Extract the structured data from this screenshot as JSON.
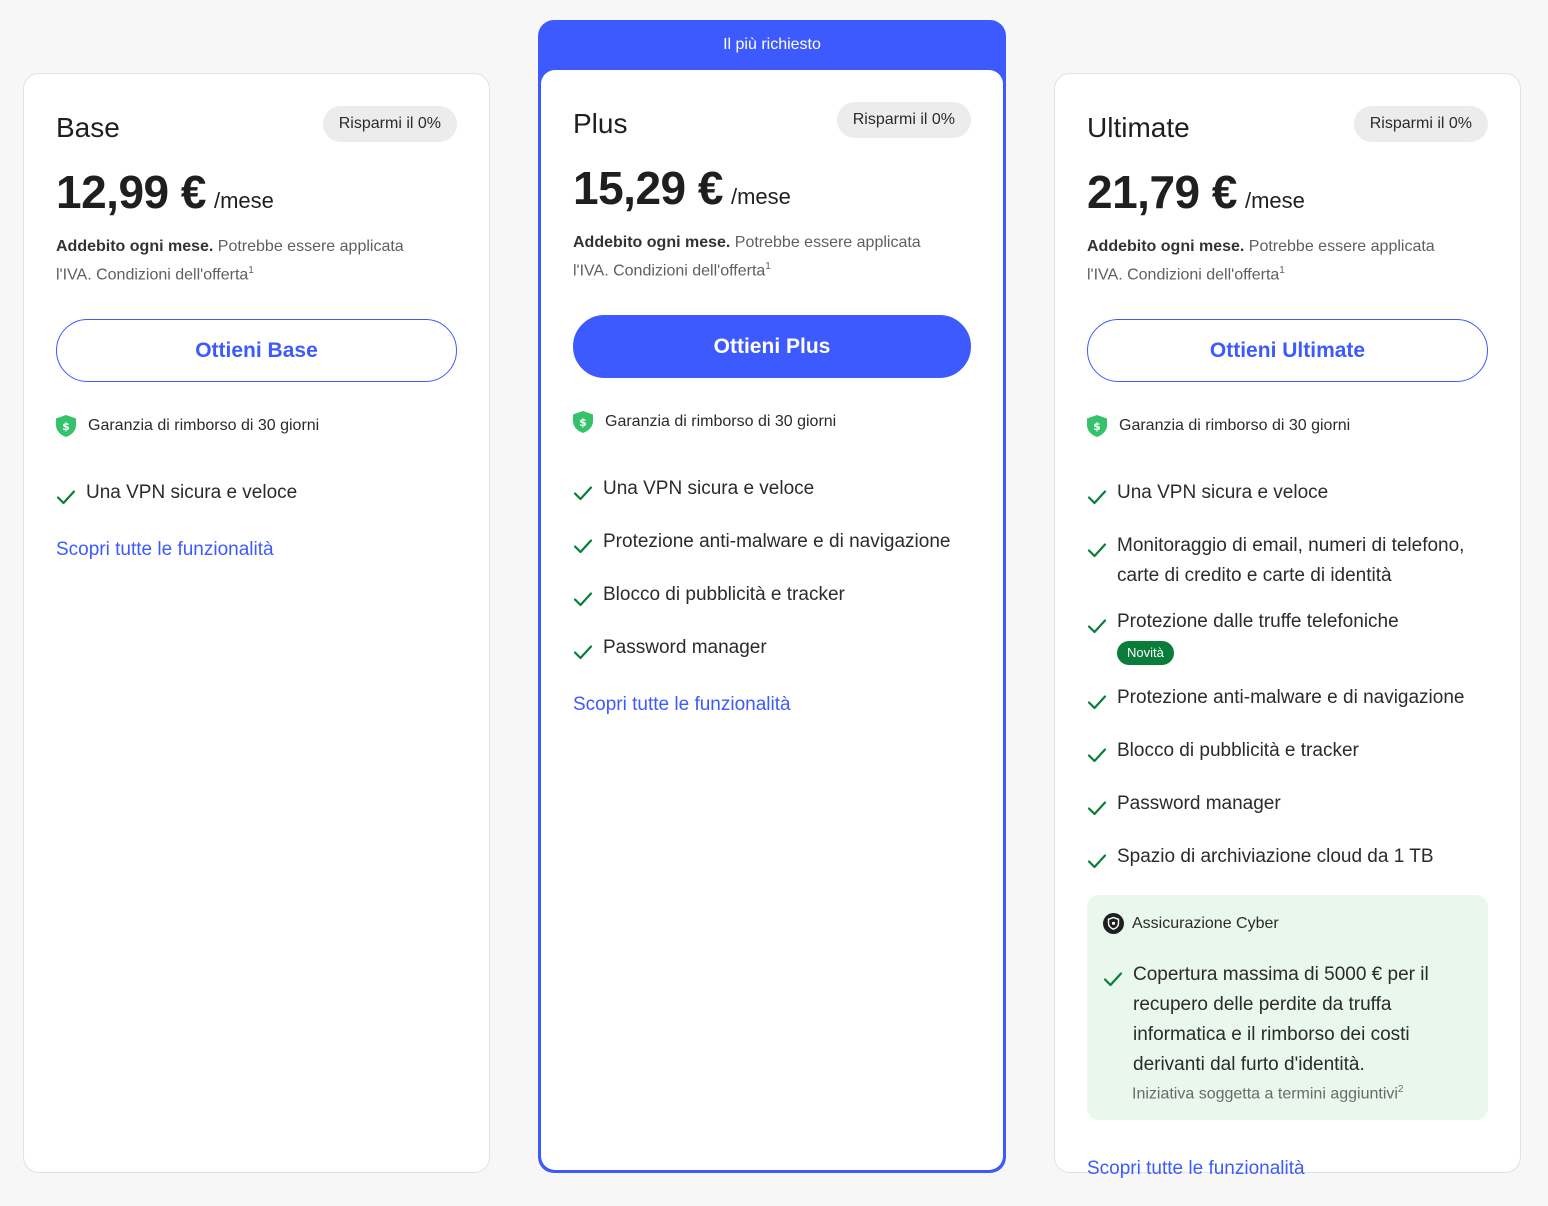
{
  "colors": {
    "accent": "#3d5afe",
    "check": "#0a7d3a",
    "shield": "#34c26a",
    "insurance_bg": "#e9f7ec"
  },
  "plans": {
    "base": {
      "name": "Base",
      "save": "Risparmi il 0%",
      "price": "12,99 €",
      "per": "/mese",
      "billing_bold": "Addebito ogni mese.",
      "billing_rest": " Potrebbe essere applicata l'IVA. Condizioni dell'offerta",
      "billing_sup": "1",
      "cta": "Ottieni Base",
      "guarantee": "Garanzia di rimborso di 30 giorni",
      "features": [
        "Una VPN sicura e veloce"
      ],
      "link": "Scopri tutte le funzionalità"
    },
    "plus": {
      "ribbon": "Il più richiesto",
      "name": "Plus",
      "save": "Risparmi il 0%",
      "price": "15,29 €",
      "per": "/mese",
      "billing_bold": "Addebito ogni mese.",
      "billing_rest": " Potrebbe essere applicata l'IVA. Condizioni dell'offerta",
      "billing_sup": "1",
      "cta": "Ottieni Plus",
      "guarantee": "Garanzia di rimborso di 30 giorni",
      "features": [
        "Una VPN sicura e veloce",
        "Protezione anti-malware e di navigazione",
        "Blocco di pubblicità e tracker",
        "Password manager"
      ],
      "link": "Scopri tutte le funzionalità"
    },
    "ultimate": {
      "name": "Ultimate",
      "save": "Risparmi il 0%",
      "price": "21,79 €",
      "per": "/mese",
      "billing_bold": "Addebito ogni mese.",
      "billing_rest": " Potrebbe essere applicata l'IVA. Condizioni dell'offerta",
      "billing_sup": "1",
      "cta": "Ottieni Ultimate",
      "guarantee": "Garanzia di rimborso di 30 giorni",
      "features": [
        "Una VPN sicura e veloce",
        "Monitoraggio di email, numeri di telefono, carte di credito e carte di identità",
        "Protezione dalle truffe telefoniche",
        "Protezione anti-malware e di navigazione",
        "Blocco di pubblicità e tracker",
        "Password manager",
        "Spazio di archiviazione cloud da 1 TB"
      ],
      "new_badge": "Novità",
      "insurance": {
        "title": "Assicurazione Cyber",
        "text": "Copertura massima di 5000 € per il recupero delle perdite da truffa informatica e il rimborso dei costi derivanti dal furto d'identità.",
        "note": "Iniziativa soggetta a termini aggiuntivi",
        "note_sup": "2"
      },
      "link": "Scopri tutte le funzionalità"
    }
  }
}
